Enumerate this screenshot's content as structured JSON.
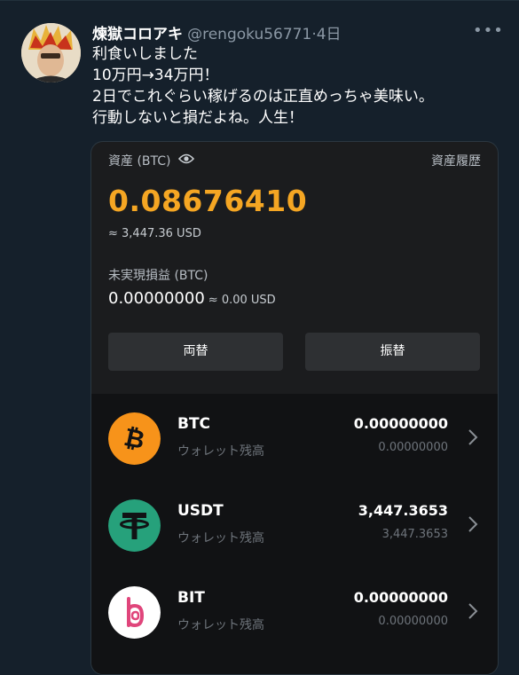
{
  "tweet": {
    "display_name": "煉獄コロアキ",
    "handle": "@rengoku56771",
    "separator": "·",
    "time": "4日",
    "more_label": "•••",
    "lines": [
      "利食いしました",
      "10万円→34万円！",
      "2日でこれぐらい稼げるのは正直めっちゃ美味い。",
      "行動しないと損だよね。人生！"
    ]
  },
  "wallet": {
    "asset_label": "資産 (BTC)",
    "history_label": "資産履歴",
    "balance": "0.08676410",
    "balance_usd": "≈ 3,447.36 USD",
    "pnl_label": "未実現損益 (BTC)",
    "pnl_value": "0.00000000",
    "pnl_usd": "≈ 0.00 USD",
    "exchange_button": "両替",
    "transfer_button": "振替",
    "colors": {
      "balance": "#f5a623",
      "card_bg": "#1b1c1e",
      "list_bg": "#111214"
    }
  },
  "coins": [
    {
      "name": "BTC",
      "sub": "ウォレット残高",
      "amount": "0.00000000",
      "amount_sub": "0.00000000",
      "icon": "bitcoin-icon",
      "color": "#f7931a"
    },
    {
      "name": "USDT",
      "sub": "ウォレット残高",
      "amount": "3,447.3653",
      "amount_sub": "3,447.3653",
      "icon": "tether-icon",
      "color": "#26a17b"
    },
    {
      "name": "BIT",
      "sub": "ウォレット残高",
      "amount": "0.00000000",
      "amount_sub": "0.00000000",
      "icon": "bit-icon",
      "color": "#ffffff"
    }
  ]
}
